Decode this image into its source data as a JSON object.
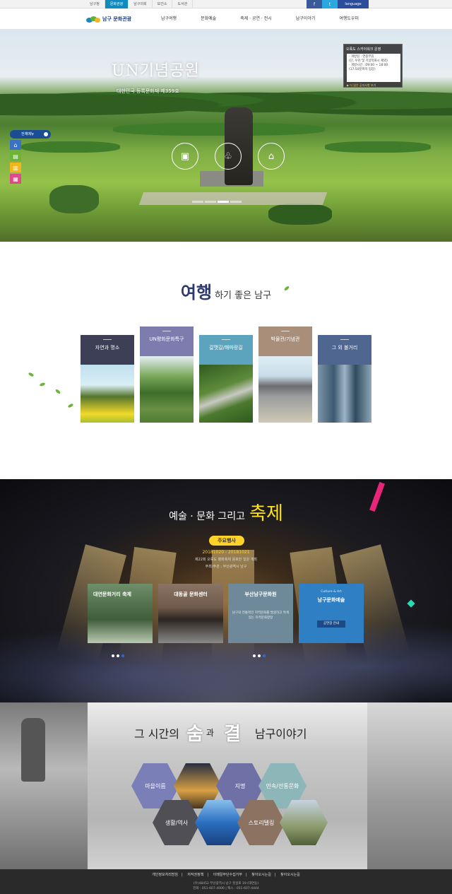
{
  "topbar": {
    "sites": [
      "남구청",
      "문화관광",
      "남구의회",
      "보건소",
      "도서관"
    ],
    "active_site": "문화관광",
    "facebook": "f",
    "twitter": "t",
    "language": "language"
  },
  "header": {
    "logo_text": "남구 문화관광",
    "menu": [
      "남구여행",
      "문화예술",
      "축제 · 공연 · 전시",
      "남구이야기",
      "여행도우미"
    ]
  },
  "hero": {
    "title": "UN기념공원",
    "subtitle": "대한민국 등록문화재 제359호",
    "notice_title": "오륙도 스카이워크 운영",
    "notice_lines": [
      "- 개방일 : 연중무휴",
      "(단, 우천 및 기상악화시 제외)",
      "- 개방시간 : 09:00 ~ 18:00",
      "(17:50분까지 입장)"
    ],
    "notice_footer": "▶ 더 많은 공지사항 보기",
    "quick_title": "전체메뉴",
    "icons": [
      "suitcase-icon",
      "tulip-field-icon",
      "building-icon"
    ]
  },
  "travel": {
    "title_big": "여행",
    "title_rest": "하기 좋은 남구",
    "cards": [
      {
        "label": "자연과 명소",
        "color": "#3c3f56"
      },
      {
        "label": "UN평화문화특구",
        "color": "#7d7cae"
      },
      {
        "label": "갈맷길/해파랑길",
        "color": "#5ca3bd"
      },
      {
        "label": "박물관/기념관",
        "color": "#a98f7a"
      },
      {
        "label": "그 외 볼거리",
        "color": "#4f6690"
      }
    ]
  },
  "art": {
    "title": "예술 · 문화 그리고",
    "fest": "축제",
    "pill": "주요행사",
    "date": "20181020 - 20181021",
    "desc1": "제22회 오륙도 평화축제 용호만 일원 개최",
    "desc2": "주최/주관 : 부산광역시 남구",
    "cards": [
      {
        "title": "대연문화거리 축제",
        "bg": "#4d6a4c"
      },
      {
        "title": "대동골 문화센터",
        "bg": "#6f5a4b"
      },
      {
        "title": "부산남구문화원",
        "bg": "#6e8a9a",
        "desc": "남구의 전통적인 지역문화를 발굴하고 특색있는 지역문화창달"
      },
      {
        "title": "남구문화예술",
        "bg": "#2e7fc4",
        "kicker": "Culture & Art",
        "button": "공연장 안내"
      }
    ]
  },
  "story": {
    "pre": "그 시간의",
    "c1": "숨",
    "mid": "과",
    "c2": "결",
    "post": "남구이야기",
    "hexes": [
      "마을이름",
      "지명",
      "민속/전통문화",
      "생활/역사",
      "스토리텔링"
    ]
  },
  "footer": {
    "links": [
      "개인정보처리방침",
      "저작권정책",
      "이메일무단수집거부",
      "찾아오시는길",
      "찾아오시는길"
    ],
    "address": "(우)48452 부산광역시 남구 못골로 19 (대연동)",
    "phone": "전화 : 051-607-4000 | 팩스 : 051-607-4444"
  }
}
